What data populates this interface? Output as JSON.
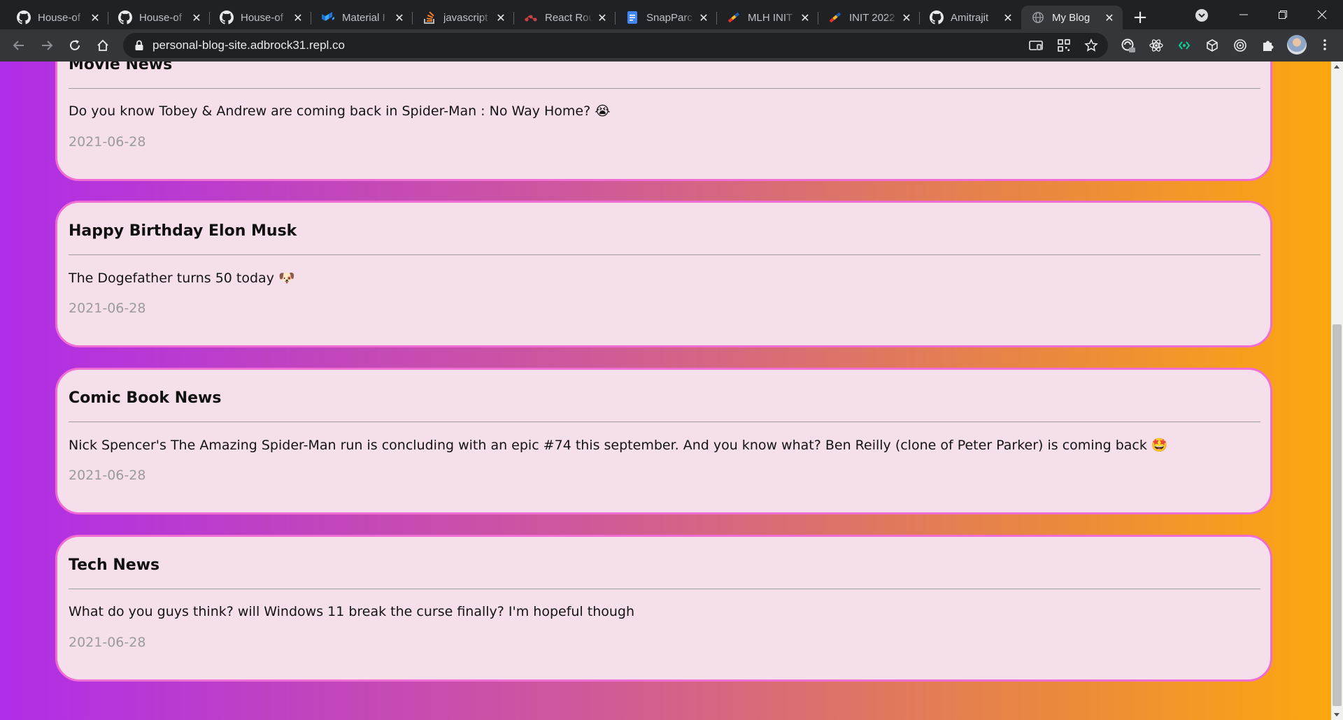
{
  "browser": {
    "tabs": [
      {
        "title": "House-of",
        "icon": "github-icon",
        "active": false
      },
      {
        "title": "House-of",
        "icon": "github-icon",
        "active": false
      },
      {
        "title": "House-of",
        "icon": "github-icon",
        "active": false
      },
      {
        "title": "Material I",
        "icon": "material-ui-icon",
        "active": false
      },
      {
        "title": "javascript",
        "icon": "stackoverflow-icon",
        "active": false
      },
      {
        "title": "React Rou",
        "icon": "react-router-icon",
        "active": false
      },
      {
        "title": "SnapParc",
        "icon": "google-docs-icon",
        "active": false
      },
      {
        "title": "MLH INIT",
        "icon": "mlh-icon",
        "active": false
      },
      {
        "title": "INIT 2022",
        "icon": "mlh-icon",
        "active": false
      },
      {
        "title": "Amitrajit",
        "icon": "github-icon",
        "active": false
      },
      {
        "title": "My Blog",
        "icon": "globe-icon",
        "active": true
      }
    ],
    "close_glyph": "✕",
    "new_tab_glyph": "+",
    "url": "personal-blog-site.adbrock31.repl.co",
    "accent": "#8ab4f8"
  },
  "page": {
    "gradient": [
      "#b02de8",
      "#cf5a98",
      "#eb8a3c",
      "#fda70f"
    ],
    "card_background": "#f5dfea",
    "card_border": "#f06dd3",
    "posts": [
      {
        "title": "Movie News",
        "body": "Do you know Tobey & Andrew are coming back in Spider-Man : No Way Home? 😭",
        "date": "2021-06-28"
      },
      {
        "title": "Happy Birthday Elon Musk",
        "body": "The Dogefather turns 50 today 🐶",
        "date": "2021-06-28"
      },
      {
        "title": "Comic Book News",
        "body": "Nick Spencer's The Amazing Spider-Man run is concluding with an epic #74 this september. And you know what? Ben Reilly (clone of Peter Parker) is coming back 🤩",
        "date": "2021-06-28"
      },
      {
        "title": "Tech News",
        "body": "What do you guys think? will Windows 11 break the curse finally? I'm hopeful though",
        "date": "2021-06-28"
      }
    ]
  }
}
